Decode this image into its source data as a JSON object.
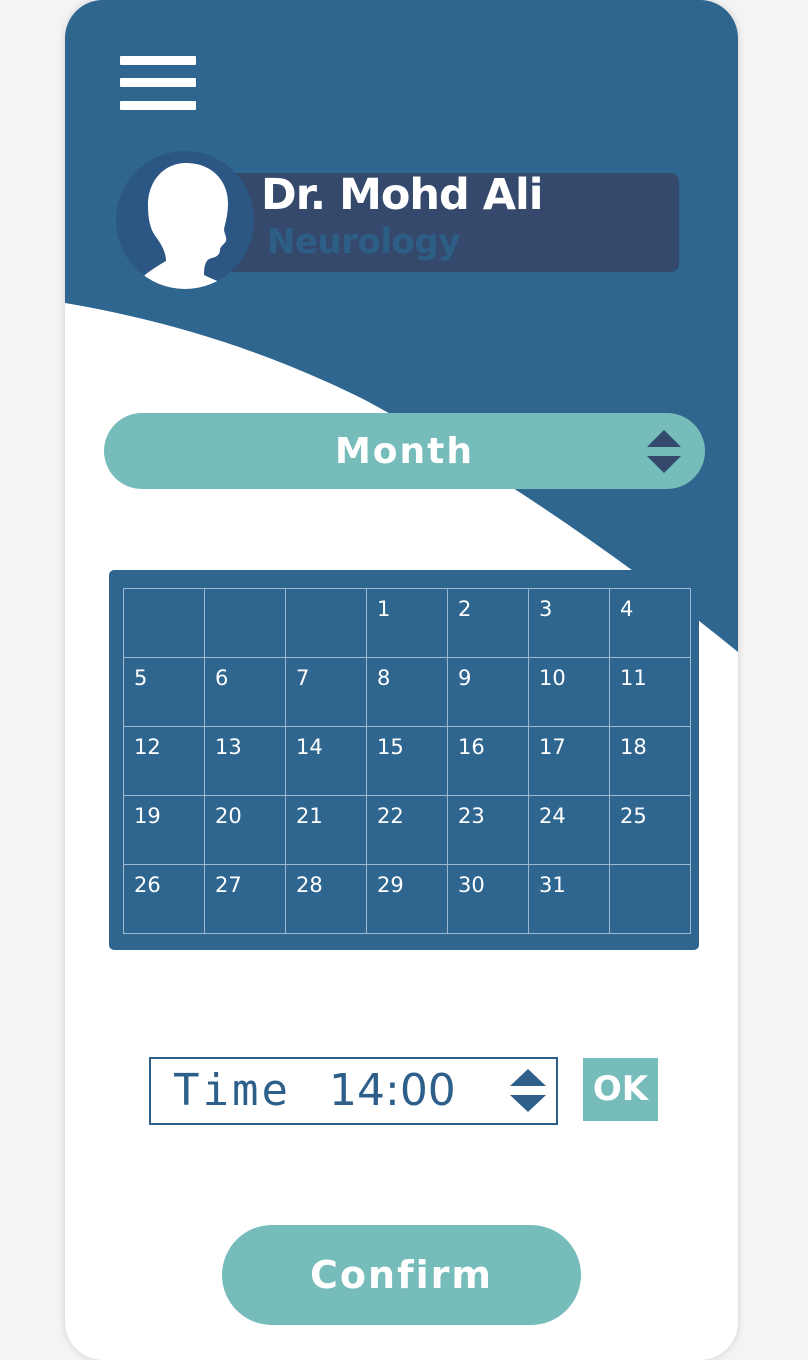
{
  "header": {
    "doctor_name": "Dr. Mohd Ali",
    "specialty": "Neurology",
    "menu_icon": "hamburger-menu-icon",
    "avatar_icon": "person-silhouette-icon"
  },
  "month_selector": {
    "label": "Month",
    "icon": "up-down-arrows-icon"
  },
  "calendar": {
    "weeks": [
      [
        "",
        "",
        "",
        "1",
        "2",
        "3",
        "4"
      ],
      [
        "5",
        "6",
        "7",
        "8",
        "9",
        "10",
        "11"
      ],
      [
        "12",
        "13",
        "14",
        "15",
        "16",
        "17",
        "18"
      ],
      [
        "19",
        "20",
        "21",
        "22",
        "23",
        "24",
        "25"
      ],
      [
        "26",
        "27",
        "28",
        "29",
        "30",
        "31",
        ""
      ]
    ]
  },
  "time_picker": {
    "label": "Time",
    "value": "14:00",
    "icon": "up-down-arrows-icon"
  },
  "ok_label": "OK",
  "confirm_label": "Confirm",
  "colors": {
    "primary_blue": "#2f6690",
    "teal": "#76bcba",
    "profile_bar": "#34496c",
    "white": "#ffffff"
  }
}
